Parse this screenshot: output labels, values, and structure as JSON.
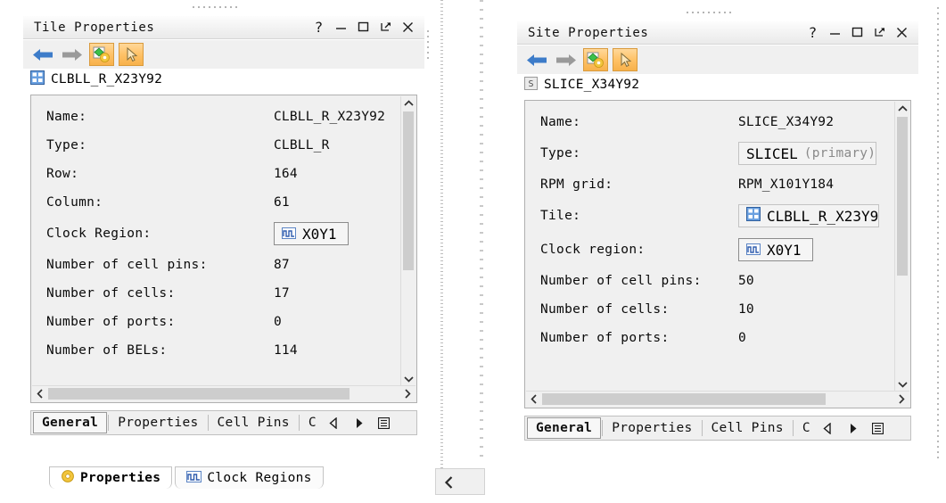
{
  "colors": {
    "panel_bg": "#f0f0f0",
    "toggle_orange": "#ffc267",
    "icon_blue": "#4f7fc8",
    "text": "#0a0a0a",
    "muted_text": "#8a8a8a"
  },
  "tile_panel": {
    "title": "Tile Properties",
    "window_controls": [
      {
        "name": "help-button",
        "glyph": "?"
      },
      {
        "name": "minimize-button",
        "glyph": "—"
      },
      {
        "name": "maximize-button",
        "glyph": "□"
      },
      {
        "name": "float-button",
        "glyph": "↗"
      },
      {
        "name": "close-button",
        "glyph": "✕"
      }
    ],
    "toolbar": {
      "back_label": "back-arrow",
      "forward_label": "forward-arrow",
      "properties_toggle_label": "properties-toggle",
      "select_toggle_label": "select-toggle"
    },
    "object": {
      "icon": "tile-grid-icon",
      "name": "CLBLL_R_X23Y92"
    },
    "properties": [
      {
        "label": "Name:",
        "value": "CLBLL_R_X23Y92",
        "boxed": false
      },
      {
        "label": "Type:",
        "value": "CLBLL_R",
        "boxed": false
      },
      {
        "label": "Row:",
        "value": "164",
        "boxed": false
      },
      {
        "label": "Column:",
        "value": "61",
        "boxed": false
      },
      {
        "label": "Clock Region:",
        "value": "X0Y1",
        "boxed": true,
        "icon": "clock-region-icon"
      },
      {
        "label": "Number of cell pins:",
        "value": "87",
        "boxed": false
      },
      {
        "label": "Number of cells:",
        "value": "17",
        "boxed": false
      },
      {
        "label": "Number of ports:",
        "value": "0",
        "boxed": false
      },
      {
        "label": "Number of BELs:",
        "value": "114",
        "boxed": false
      }
    ],
    "tabs": [
      {
        "label": "General",
        "active": true
      },
      {
        "label": "Properties",
        "active": false
      },
      {
        "label": "Cell Pins",
        "active": false
      },
      {
        "label": "C",
        "active": false
      }
    ],
    "tab_nav": {
      "prev_label": "◁",
      "next_label": "▶",
      "list_label": "▤"
    }
  },
  "site_panel": {
    "title": "Site Properties",
    "window_controls": [
      {
        "name": "help-button",
        "glyph": "?"
      },
      {
        "name": "minimize-button",
        "glyph": "—"
      },
      {
        "name": "maximize-button",
        "glyph": "□"
      },
      {
        "name": "float-button",
        "glyph": "↗"
      },
      {
        "name": "close-button",
        "glyph": "✕"
      }
    ],
    "object": {
      "icon": "site-icon",
      "name": "SLICE_X34Y92"
    },
    "properties": [
      {
        "label": "Name:",
        "value": "SLICE_X34Y92",
        "boxed": false
      },
      {
        "label": "Type:",
        "value": "SLICEL",
        "suffix": "(primary)",
        "boxed": true,
        "flat": true
      },
      {
        "label": "RPM grid:",
        "value": "RPM_X101Y184",
        "boxed": false
      },
      {
        "label": "Tile:",
        "value": "CLBLL_R_X23Y9",
        "boxed": true,
        "flat": true,
        "icon": "tile-grid-icon"
      },
      {
        "label": "Clock region:",
        "value": "X0Y1",
        "boxed": true,
        "icon": "clock-region-icon"
      },
      {
        "label": "Number of cell pins:",
        "value": "50",
        "boxed": false
      },
      {
        "label": "Number of cells:",
        "value": "10",
        "boxed": false
      },
      {
        "label": "Number of ports:",
        "value": "0",
        "boxed": false
      }
    ],
    "tabs": [
      {
        "label": "General",
        "active": true
      },
      {
        "label": "Properties",
        "active": false
      },
      {
        "label": "Cell Pins",
        "active": false
      },
      {
        "label": "C",
        "active": false
      }
    ],
    "tab_nav": {
      "prev_label": "◁",
      "next_label": "▶",
      "list_label": "▤"
    }
  },
  "bottom_tabs": [
    {
      "label": "Properties",
      "icon": "properties-icon",
      "active": true
    },
    {
      "label": "Clock Regions",
      "icon": "clock-region-icon",
      "active": false
    }
  ],
  "gutter": {
    "collapse_label": "❮"
  }
}
